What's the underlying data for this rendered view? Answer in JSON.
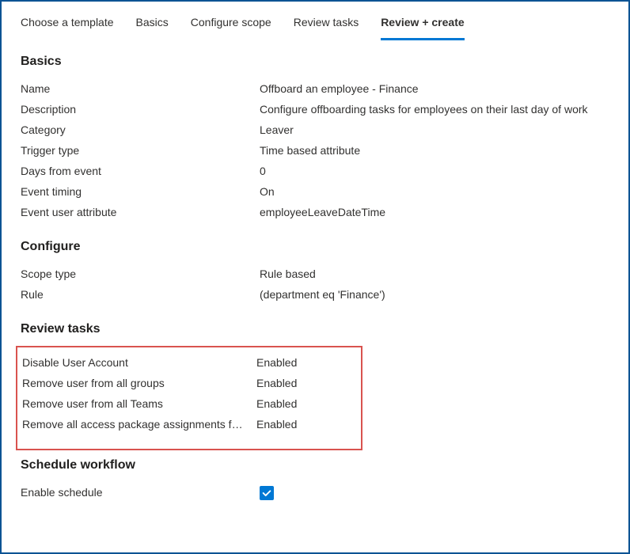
{
  "tabs": {
    "choose_template": "Choose a template",
    "basics": "Basics",
    "configure_scope": "Configure scope",
    "review_tasks": "Review tasks",
    "review_create": "Review + create"
  },
  "sections": {
    "basics": {
      "title": "Basics",
      "name_label": "Name",
      "name_value": "Offboard an employee - Finance",
      "description_label": "Description",
      "description_value": "Configure offboarding tasks for employees on their last day of work",
      "category_label": "Category",
      "category_value": "Leaver",
      "trigger_type_label": "Trigger type",
      "trigger_type_value": "Time based attribute",
      "days_from_event_label": "Days from event",
      "days_from_event_value": "0",
      "event_timing_label": "Event timing",
      "event_timing_value": "On",
      "event_user_attribute_label": "Event user attribute",
      "event_user_attribute_value": "employeeLeaveDateTime"
    },
    "configure": {
      "title": "Configure",
      "scope_type_label": "Scope type",
      "scope_type_value": "Rule based",
      "rule_label": "Rule",
      "rule_value": " (department eq 'Finance')"
    },
    "review_tasks": {
      "title": "Review tasks",
      "tasks": [
        {
          "name": "Disable User Account",
          "status": "Enabled"
        },
        {
          "name": "Remove user from all groups",
          "status": "Enabled"
        },
        {
          "name": "Remove user from all Teams",
          "status": "Enabled"
        },
        {
          "name": "Remove all access package assignments f…",
          "status": "Enabled"
        }
      ]
    },
    "schedule": {
      "title": "Schedule workflow",
      "enable_schedule_label": "Enable schedule"
    }
  }
}
